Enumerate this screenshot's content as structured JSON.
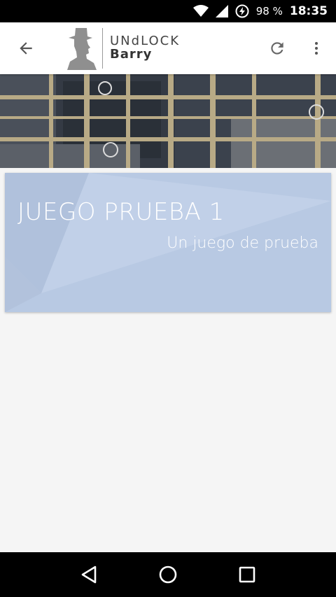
{
  "status_bar": {
    "battery_percent": "98 %",
    "time": "18:35",
    "icons": [
      "wifi-icon",
      "cell-signal-icon",
      "battery-saver-icon"
    ]
  },
  "app_bar": {
    "logo_line1": "UNdLOCK",
    "logo_line2": "Barry",
    "icons": [
      "back-arrow-icon",
      "refresh-icon",
      "more-vert-icon"
    ]
  },
  "game_card": {
    "title": "JUEGO PRUEBA 1",
    "subtitle": "Un juego de prueba",
    "background_color": "#b8c9e3"
  },
  "nav_bar": {
    "icons": [
      "back-triangle-icon",
      "home-circle-icon",
      "recents-square-icon"
    ]
  }
}
